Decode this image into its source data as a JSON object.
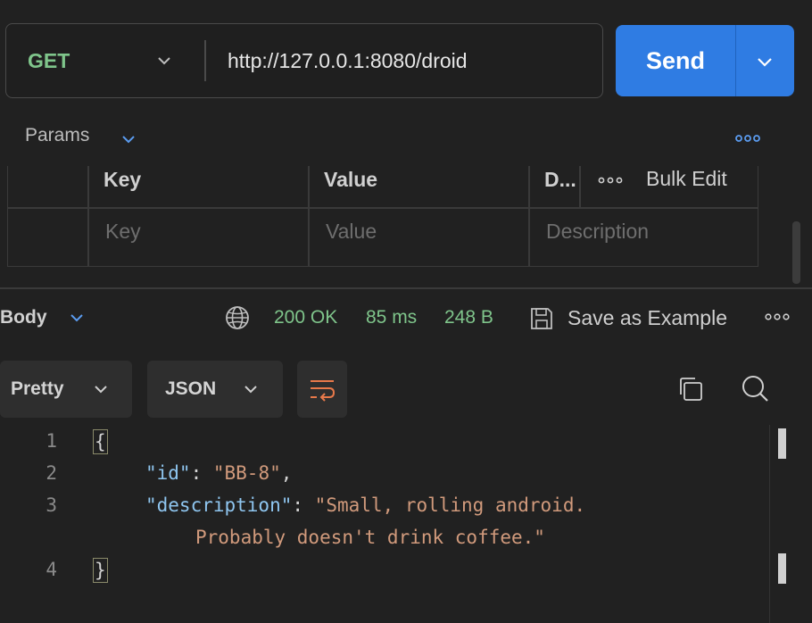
{
  "request": {
    "method": "GET",
    "url": "http://127.0.0.1:8080/droid",
    "send_label": "Send"
  },
  "params": {
    "label": "Params",
    "table": {
      "headers": [
        "Key",
        "Value",
        "D..."
      ],
      "bulk_edit": "Bulk Edit",
      "placeholders": [
        "Key",
        "Value",
        "Description"
      ]
    }
  },
  "response": {
    "body_label": "Body",
    "status": "200 OK",
    "time": "85 ms",
    "size": "248 B",
    "save_example": "Save as Example",
    "view_mode": "Pretty",
    "format": "JSON"
  },
  "code": {
    "line_numbers": [
      "1",
      "2",
      "3",
      "4"
    ],
    "open_brace": "{",
    "close_brace": "}",
    "id_key": "\"id\"",
    "id_value": "\"BB-8\"",
    "desc_key": "\"description\"",
    "desc_value_line1": "\"Small, rolling android.",
    "desc_value_line2": "Probably doesn't drink coffee.\""
  },
  "colors": {
    "accent": "#2f7ce3",
    "status_ok": "#7fc58b",
    "json_key": "#8fc6f0",
    "json_string": "#d19a7c",
    "wrap_icon": "#e8794a"
  }
}
